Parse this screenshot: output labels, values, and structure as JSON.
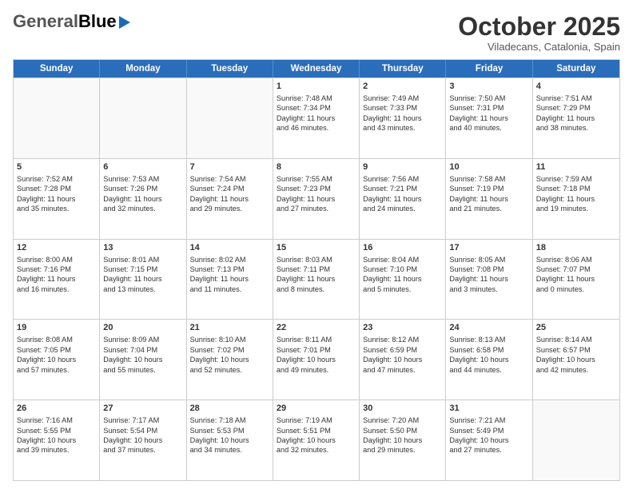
{
  "logo": {
    "line1": "General",
    "line2": "Blue"
  },
  "header": {
    "month": "October 2025",
    "location": "Viladecans, Catalonia, Spain"
  },
  "days_of_week": [
    "Sunday",
    "Monday",
    "Tuesday",
    "Wednesday",
    "Thursday",
    "Friday",
    "Saturday"
  ],
  "weeks": [
    [
      {
        "day": "",
        "info": ""
      },
      {
        "day": "",
        "info": ""
      },
      {
        "day": "",
        "info": ""
      },
      {
        "day": "1",
        "info": "Sunrise: 7:48 AM\nSunset: 7:34 PM\nDaylight: 11 hours\nand 46 minutes."
      },
      {
        "day": "2",
        "info": "Sunrise: 7:49 AM\nSunset: 7:33 PM\nDaylight: 11 hours\nand 43 minutes."
      },
      {
        "day": "3",
        "info": "Sunrise: 7:50 AM\nSunset: 7:31 PM\nDaylight: 11 hours\nand 40 minutes."
      },
      {
        "day": "4",
        "info": "Sunrise: 7:51 AM\nSunset: 7:29 PM\nDaylight: 11 hours\nand 38 minutes."
      }
    ],
    [
      {
        "day": "5",
        "info": "Sunrise: 7:52 AM\nSunset: 7:28 PM\nDaylight: 11 hours\nand 35 minutes."
      },
      {
        "day": "6",
        "info": "Sunrise: 7:53 AM\nSunset: 7:26 PM\nDaylight: 11 hours\nand 32 minutes."
      },
      {
        "day": "7",
        "info": "Sunrise: 7:54 AM\nSunset: 7:24 PM\nDaylight: 11 hours\nand 29 minutes."
      },
      {
        "day": "8",
        "info": "Sunrise: 7:55 AM\nSunset: 7:23 PM\nDaylight: 11 hours\nand 27 minutes."
      },
      {
        "day": "9",
        "info": "Sunrise: 7:56 AM\nSunset: 7:21 PM\nDaylight: 11 hours\nand 24 minutes."
      },
      {
        "day": "10",
        "info": "Sunrise: 7:58 AM\nSunset: 7:19 PM\nDaylight: 11 hours\nand 21 minutes."
      },
      {
        "day": "11",
        "info": "Sunrise: 7:59 AM\nSunset: 7:18 PM\nDaylight: 11 hours\nand 19 minutes."
      }
    ],
    [
      {
        "day": "12",
        "info": "Sunrise: 8:00 AM\nSunset: 7:16 PM\nDaylight: 11 hours\nand 16 minutes."
      },
      {
        "day": "13",
        "info": "Sunrise: 8:01 AM\nSunset: 7:15 PM\nDaylight: 11 hours\nand 13 minutes."
      },
      {
        "day": "14",
        "info": "Sunrise: 8:02 AM\nSunset: 7:13 PM\nDaylight: 11 hours\nand 11 minutes."
      },
      {
        "day": "15",
        "info": "Sunrise: 8:03 AM\nSunset: 7:11 PM\nDaylight: 11 hours\nand 8 minutes."
      },
      {
        "day": "16",
        "info": "Sunrise: 8:04 AM\nSunset: 7:10 PM\nDaylight: 11 hours\nand 5 minutes."
      },
      {
        "day": "17",
        "info": "Sunrise: 8:05 AM\nSunset: 7:08 PM\nDaylight: 11 hours\nand 3 minutes."
      },
      {
        "day": "18",
        "info": "Sunrise: 8:06 AM\nSunset: 7:07 PM\nDaylight: 11 hours\nand 0 minutes."
      }
    ],
    [
      {
        "day": "19",
        "info": "Sunrise: 8:08 AM\nSunset: 7:05 PM\nDaylight: 10 hours\nand 57 minutes."
      },
      {
        "day": "20",
        "info": "Sunrise: 8:09 AM\nSunset: 7:04 PM\nDaylight: 10 hours\nand 55 minutes."
      },
      {
        "day": "21",
        "info": "Sunrise: 8:10 AM\nSunset: 7:02 PM\nDaylight: 10 hours\nand 52 minutes."
      },
      {
        "day": "22",
        "info": "Sunrise: 8:11 AM\nSunset: 7:01 PM\nDaylight: 10 hours\nand 49 minutes."
      },
      {
        "day": "23",
        "info": "Sunrise: 8:12 AM\nSunset: 6:59 PM\nDaylight: 10 hours\nand 47 minutes."
      },
      {
        "day": "24",
        "info": "Sunrise: 8:13 AM\nSunset: 6:58 PM\nDaylight: 10 hours\nand 44 minutes."
      },
      {
        "day": "25",
        "info": "Sunrise: 8:14 AM\nSunset: 6:57 PM\nDaylight: 10 hours\nand 42 minutes."
      }
    ],
    [
      {
        "day": "26",
        "info": "Sunrise: 7:16 AM\nSunset: 5:55 PM\nDaylight: 10 hours\nand 39 minutes."
      },
      {
        "day": "27",
        "info": "Sunrise: 7:17 AM\nSunset: 5:54 PM\nDaylight: 10 hours\nand 37 minutes."
      },
      {
        "day": "28",
        "info": "Sunrise: 7:18 AM\nSunset: 5:53 PM\nDaylight: 10 hours\nand 34 minutes."
      },
      {
        "day": "29",
        "info": "Sunrise: 7:19 AM\nSunset: 5:51 PM\nDaylight: 10 hours\nand 32 minutes."
      },
      {
        "day": "30",
        "info": "Sunrise: 7:20 AM\nSunset: 5:50 PM\nDaylight: 10 hours\nand 29 minutes."
      },
      {
        "day": "31",
        "info": "Sunrise: 7:21 AM\nSunset: 5:49 PM\nDaylight: 10 hours\nand 27 minutes."
      },
      {
        "day": "",
        "info": ""
      }
    ]
  ]
}
